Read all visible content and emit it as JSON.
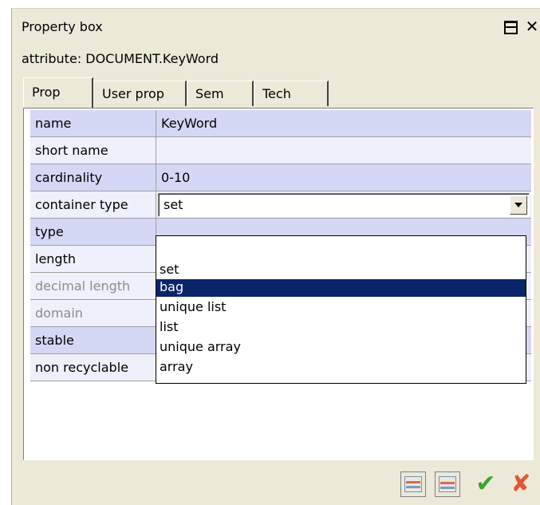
{
  "window": {
    "title": "Property box",
    "subtitle": "attribute: DOCUMENT.KeyWord",
    "close_glyph": "✕"
  },
  "tabs": [
    {
      "label": "Prop",
      "active": true
    },
    {
      "label": "User prop",
      "active": false
    },
    {
      "label": "Sem",
      "active": false
    },
    {
      "label": "Tech",
      "active": false
    }
  ],
  "rows": {
    "name": {
      "label": "name",
      "value": "KeyWord"
    },
    "short_name": {
      "label": "short name",
      "value": ""
    },
    "cardinality": {
      "label": "cardinality",
      "value": "0-10"
    },
    "container_type": {
      "label": "container type",
      "value": "set"
    },
    "type": {
      "label": "type",
      "value": ""
    },
    "length": {
      "label": "length",
      "value": ""
    },
    "decimal_length": {
      "label": "decimal length",
      "value": ""
    },
    "domain": {
      "label": "domain",
      "value": ""
    },
    "stable": {
      "label": "stable",
      "checked": false
    },
    "non_recyclable": {
      "label": "non recyclable",
      "checked": false
    }
  },
  "dropdown": {
    "options": [
      "",
      "set",
      "bag",
      "unique list",
      "list",
      "unique array",
      "array"
    ],
    "selected": "bag"
  },
  "buttons": {
    "ok_glyph": "✔",
    "cancel_glyph": "✘"
  },
  "colors": {
    "row_dark": "#d4d8f4",
    "row_light": "#eef0fb",
    "selection": "#0a246a",
    "ok": "#3aa52e",
    "cancel": "#e2562f"
  }
}
